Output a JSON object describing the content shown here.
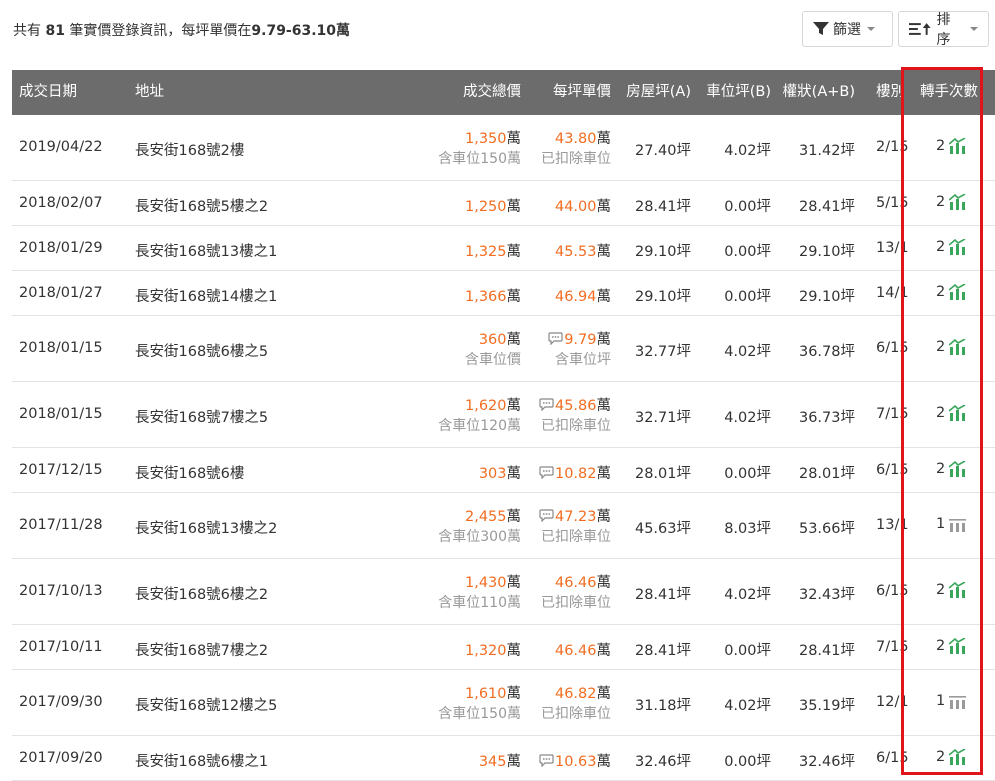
{
  "summary": {
    "prefix": "共有 ",
    "count": "81",
    "mid": " 筆實價登錄資訊，每坪單價在",
    "range": "9.79-63.10萬"
  },
  "toolbar": {
    "filter_label": "篩選",
    "sort_label": "排序"
  },
  "columns": {
    "date": "成交日期",
    "address": "地址",
    "total_price": "成交總價",
    "unit_price": "每坪單價",
    "house_area": "房屋坪(A)",
    "parking_area": "車位坪(B)",
    "ownership_area": "權狀(A+B)",
    "floor": "樓別",
    "turnover": "轉手次數"
  },
  "colors": {
    "header_bg": "#6c6c6c",
    "price_accent": "#f26d21",
    "highlight_border": "#e0141b",
    "trend_up": "#3aa65b",
    "trend_flat": "#9a9a9a"
  },
  "rows": [
    {
      "date": "2019/04/22",
      "address": "長安街168號2樓",
      "price": "1,350",
      "price_unit": "萬",
      "price_sub": "含車位150萬",
      "unit_price": "43.80",
      "unit_unit": "萬",
      "unit_sub": "已扣除車位",
      "comment": false,
      "house": "27.40坪",
      "parking": "4.02坪",
      "ownership": "31.42坪",
      "floor": "2/15",
      "turnover": "2",
      "trend": "up-icon"
    },
    {
      "date": "2018/02/07",
      "address": "長安街168號5樓之2",
      "price": "1,250",
      "price_unit": "萬",
      "price_sub": "",
      "unit_price": "44.00",
      "unit_unit": "萬",
      "unit_sub": "",
      "comment": false,
      "house": "28.41坪",
      "parking": "0.00坪",
      "ownership": "28.41坪",
      "floor": "5/15",
      "turnover": "2",
      "trend": "up-icon"
    },
    {
      "date": "2018/01/29",
      "address": "長安街168號13樓之1",
      "price": "1,325",
      "price_unit": "萬",
      "price_sub": "",
      "unit_price": "45.53",
      "unit_unit": "萬",
      "unit_sub": "",
      "comment": false,
      "house": "29.10坪",
      "parking": "0.00坪",
      "ownership": "29.10坪",
      "floor": "13/15",
      "turnover": "2",
      "trend": "up-icon"
    },
    {
      "date": "2018/01/27",
      "address": "長安街168號14樓之1",
      "price": "1,366",
      "price_unit": "萬",
      "price_sub": "",
      "unit_price": "46.94",
      "unit_unit": "萬",
      "unit_sub": "",
      "comment": false,
      "house": "29.10坪",
      "parking": "0.00坪",
      "ownership": "29.10坪",
      "floor": "14/15",
      "turnover": "2",
      "trend": "up-icon"
    },
    {
      "date": "2018/01/15",
      "address": "長安街168號6樓之5",
      "price": "360",
      "price_unit": "萬",
      "price_sub": "含車位價",
      "unit_price": "9.79",
      "unit_unit": "萬",
      "unit_sub": "含車位坪",
      "comment": true,
      "house": "32.77坪",
      "parking": "4.02坪",
      "ownership": "36.78坪",
      "floor": "6/15",
      "turnover": "2",
      "trend": "up-icon"
    },
    {
      "date": "2018/01/15",
      "address": "長安街168號7樓之5",
      "price": "1,620",
      "price_unit": "萬",
      "price_sub": "含車位120萬",
      "unit_price": "45.86",
      "unit_unit": "萬",
      "unit_sub": "已扣除車位",
      "comment": true,
      "house": "32.71坪",
      "parking": "4.02坪",
      "ownership": "36.73坪",
      "floor": "7/15",
      "turnover": "2",
      "trend": "up-icon"
    },
    {
      "date": "2017/12/15",
      "address": "長安街168號6樓",
      "price": "303",
      "price_unit": "萬",
      "price_sub": "",
      "unit_price": "10.82",
      "unit_unit": "萬",
      "unit_sub": "",
      "comment": true,
      "house": "28.01坪",
      "parking": "0.00坪",
      "ownership": "28.01坪",
      "floor": "6/15",
      "turnover": "2",
      "trend": "up-icon"
    },
    {
      "date": "2017/11/28",
      "address": "長安街168號13樓之2",
      "price": "2,455",
      "price_unit": "萬",
      "price_sub": "含車位300萬",
      "unit_price": "47.23",
      "unit_unit": "萬",
      "unit_sub": "已扣除車位",
      "comment": true,
      "house": "45.63坪",
      "parking": "8.03坪",
      "ownership": "53.66坪",
      "floor": "13/15",
      "turnover": "1",
      "trend": "flat-icon"
    },
    {
      "date": "2017/10/13",
      "address": "長安街168號6樓之2",
      "price": "1,430",
      "price_unit": "萬",
      "price_sub": "含車位110萬",
      "unit_price": "46.46",
      "unit_unit": "萬",
      "unit_sub": "已扣除車位",
      "comment": false,
      "house": "28.41坪",
      "parking": "4.02坪",
      "ownership": "32.43坪",
      "floor": "6/15",
      "turnover": "2",
      "trend": "up-icon"
    },
    {
      "date": "2017/10/11",
      "address": "長安街168號7樓之2",
      "price": "1,320",
      "price_unit": "萬",
      "price_sub": "",
      "unit_price": "46.46",
      "unit_unit": "萬",
      "unit_sub": "",
      "comment": false,
      "house": "28.41坪",
      "parking": "0.00坪",
      "ownership": "28.41坪",
      "floor": "7/15",
      "turnover": "2",
      "trend": "up-icon"
    },
    {
      "date": "2017/09/30",
      "address": "長安街168號12樓之5",
      "price": "1,610",
      "price_unit": "萬",
      "price_sub": "含車位150萬",
      "unit_price": "46.82",
      "unit_unit": "萬",
      "unit_sub": "已扣除車位",
      "comment": false,
      "house": "31.18坪",
      "parking": "4.02坪",
      "ownership": "35.19坪",
      "floor": "12/15",
      "turnover": "1",
      "trend": "flat-icon"
    },
    {
      "date": "2017/09/20",
      "address": "長安街168號6樓之1",
      "price": "345",
      "price_unit": "萬",
      "price_sub": "",
      "unit_price": "10.63",
      "unit_unit": "萬",
      "unit_sub": "",
      "comment": true,
      "house": "32.46坪",
      "parking": "0.00坪",
      "ownership": "32.46坪",
      "floor": "6/15",
      "turnover": "2",
      "trend": "up-icon"
    }
  ]
}
